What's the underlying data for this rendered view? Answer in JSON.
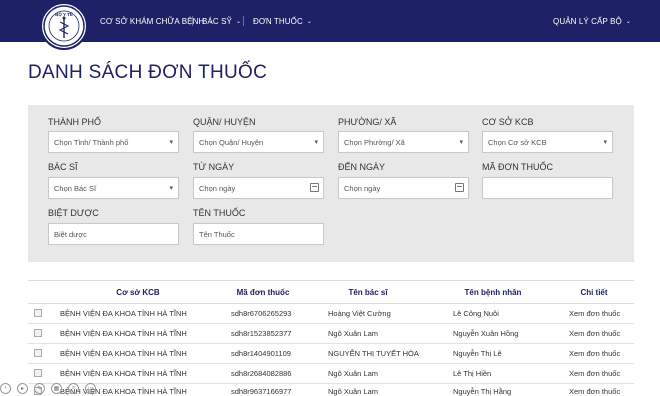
{
  "header": {
    "logo_alt": "BỘ Y TẾ",
    "nav": [
      {
        "label": "CƠ SỞ KHÁM CHỮA BỆNH",
        "has_caret": true
      },
      {
        "label": "BÁC SỸ",
        "has_caret": true
      },
      {
        "label": "ĐƠN THUỐC",
        "has_caret": true
      }
    ],
    "admin": {
      "label": "QUẢN LÝ CẤP BỘ",
      "has_caret": true
    }
  },
  "page": {
    "title": "DANH SÁCH ĐƠN THUỐC"
  },
  "filters": {
    "city": {
      "label": "THÀNH PHỐ",
      "value": "Chọn Tỉnh/ Thành phố"
    },
    "district": {
      "label": "QUẬN/ HUYỆN",
      "value": "Chọn Quận/ Huyện"
    },
    "ward": {
      "label": "PHƯỜNG/ XÃ",
      "value": "Chọn Phường/ Xã"
    },
    "facility": {
      "label": "CƠ SỞ KCB",
      "value": "Chọn Cơ sở KCB"
    },
    "doctor": {
      "label": "BÁC SĨ",
      "value": "Chọn Bác Sĩ"
    },
    "from_date": {
      "label": "TỪ NGÀY",
      "placeholder": "Chọn ngày"
    },
    "to_date": {
      "label": "ĐẾN NGÀY",
      "placeholder": "Chọn ngày"
    },
    "prescription_code": {
      "label": "MÃ ĐƠN THUỐC",
      "placeholder": ""
    },
    "brand_name": {
      "label": "BIỆT DƯỢC",
      "placeholder": "Biệt dược"
    },
    "drug_name": {
      "label": "TÊN THUỐC",
      "placeholder": "Tên Thuốc"
    }
  },
  "table": {
    "headers": [
      "Cơ sở KCB",
      "Mã đơn thuốc",
      "Tên bác sĩ",
      "Tên bệnh nhân",
      "Chi tiết"
    ],
    "rows": [
      {
        "facility": "BỆNH VIỆN ĐA KHOA TỈNH HÀ TĨNH",
        "code": "sdh8r6706265293",
        "doctor": "Hoàng Việt Cường",
        "patient": "Lê Công Nuôi",
        "detail": "Xem đơn thuốc"
      },
      {
        "facility": "BỆNH VIỆN ĐA KHOA TỈNH HÀ TĨNH",
        "code": "sdh8r1523852377",
        "doctor": "Ngô Xuân Lam",
        "patient": "Nguyễn Xuân Hồng",
        "detail": "Xem đơn thuốc"
      },
      {
        "facility": "BỆNH VIỆN ĐA KHOA TỈNH HÀ TĨNH",
        "code": "sdh8r1404901109",
        "doctor": "NGUYỄN THỊ TUYẾT HÒA",
        "patient": "Nguyễn Thị Lê",
        "detail": "Xem đơn thuốc"
      },
      {
        "facility": "BỆNH VIỆN ĐA KHOA TỈNH HÀ TĨNH",
        "code": "sdh8r2684082886",
        "doctor": "Ngô Xuân Lam",
        "patient": "Lê Thị Hiền",
        "detail": "Xem đơn thuốc"
      },
      {
        "facility": "BỆNH VIỆN ĐA KHOA TỈNH HÀ TĨNH",
        "code": "sdh8r9637166977",
        "doctor": "Ngô Xuân Lam",
        "patient": "Nguyễn Thị Hằng",
        "detail": "Xem đơn thuốc"
      }
    ]
  },
  "colors": {
    "navy": "#1e2166",
    "panel": "#e8e8e8"
  }
}
